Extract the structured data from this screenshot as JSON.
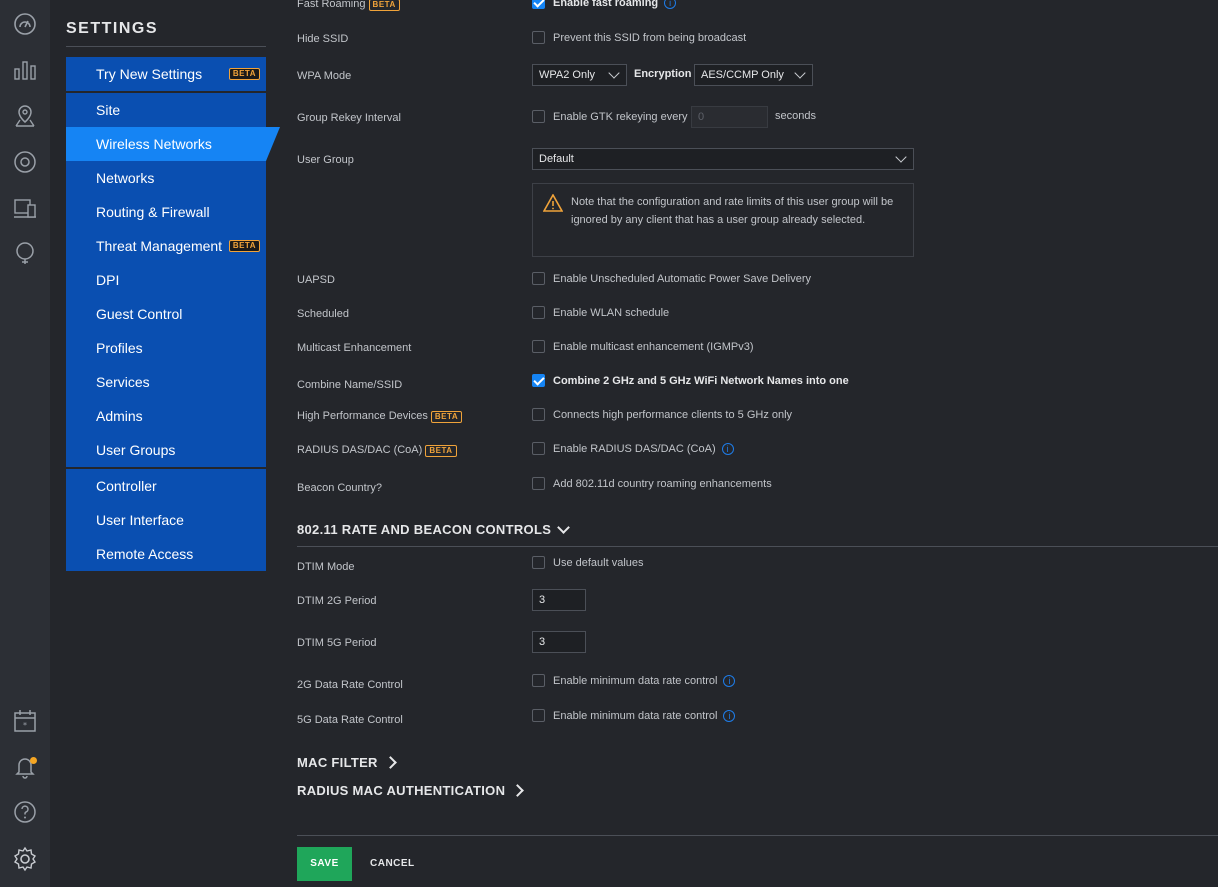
{
  "rail": {
    "top_icons": [
      "dashboard-icon",
      "statistics-icon",
      "map-icon",
      "devices-icon",
      "clients-icon",
      "insights-icon"
    ],
    "bottom_icons": [
      "events-icon",
      "alerts-icon",
      "help-icon",
      "settings-icon"
    ]
  },
  "sidebar": {
    "title": "SETTINGS",
    "try_new": {
      "label": "Try New Settings",
      "badge": "BETA"
    },
    "items": [
      {
        "label": "Site"
      },
      {
        "label": "Wireless Networks"
      },
      {
        "label": "Networks"
      },
      {
        "label": "Routing & Firewall"
      },
      {
        "label": "Threat Management",
        "badge": "BETA"
      },
      {
        "label": "DPI"
      },
      {
        "label": "Guest Control"
      },
      {
        "label": "Profiles"
      },
      {
        "label": "Services"
      },
      {
        "label": "Admins"
      },
      {
        "label": "User Groups"
      }
    ],
    "items2": [
      {
        "label": "Controller"
      },
      {
        "label": "User Interface"
      },
      {
        "label": "Remote Access"
      }
    ]
  },
  "form": {
    "fast_roaming": {
      "label": "Fast Roaming",
      "badge": "BETA",
      "text": "Enable fast roaming",
      "checked": true
    },
    "hide_ssid": {
      "label": "Hide SSID",
      "text": "Prevent this SSID from being broadcast"
    },
    "wpa_mode": {
      "label": "WPA Mode",
      "value": "WPA2 Only",
      "encryption_label": "Encryption",
      "encryption_value": "AES/CCMP Only"
    },
    "group_rekey": {
      "label": "Group Rekey Interval",
      "text": "Enable GTK rekeying every",
      "value": "0",
      "unit": "seconds"
    },
    "user_group": {
      "label": "User Group",
      "value": "Default",
      "note": "Note that the configuration and rate limits of this user group will be ignored by any client that has a user group already selected."
    },
    "uapsd": {
      "label": "UAPSD",
      "text": "Enable Unscheduled Automatic Power Save Delivery"
    },
    "scheduled": {
      "label": "Scheduled",
      "text": "Enable WLAN schedule"
    },
    "multicast": {
      "label": "Multicast Enhancement",
      "text": "Enable multicast enhancement (IGMPv3)"
    },
    "combine": {
      "label": "Combine Name/SSID",
      "text": "Combine 2 GHz and 5 GHz WiFi Network Names into one",
      "checked": true
    },
    "high_perf": {
      "label": "High Performance Devices",
      "badge": "BETA",
      "text": "Connects high performance clients to 5 GHz only"
    },
    "radius_das": {
      "label": "RADIUS DAS/DAC (CoA)",
      "badge": "BETA",
      "text": "Enable RADIUS DAS/DAC (CoA)"
    },
    "beacon_country": {
      "label": "Beacon Country?",
      "text": "Add 802.11d country roaming enhancements"
    }
  },
  "rate_section": {
    "title": "802.11 RATE AND BEACON CONTROLS",
    "dtim_mode": {
      "label": "DTIM Mode",
      "text": "Use default values"
    },
    "dtim_2g": {
      "label": "DTIM 2G Period",
      "value": "3"
    },
    "dtim_5g": {
      "label": "DTIM 5G Period",
      "value": "3"
    },
    "rate_2g": {
      "label": "2G Data Rate Control",
      "text": "Enable minimum data rate control"
    },
    "rate_5g": {
      "label": "5G Data Rate Control",
      "text": "Enable minimum data rate control"
    }
  },
  "mac_filter": {
    "title": "MAC FILTER"
  },
  "radius_mac": {
    "title": "RADIUS MAC AUTHENTICATION"
  },
  "actions": {
    "save": "SAVE",
    "cancel": "CANCEL"
  },
  "info_glyph": "i",
  "colors": {
    "accent": "#1584f4",
    "nav_bg": "#0a4fb1",
    "save": "#1fa65a",
    "beta": "#f0a33a",
    "alert_dot": "#f5a623"
  }
}
